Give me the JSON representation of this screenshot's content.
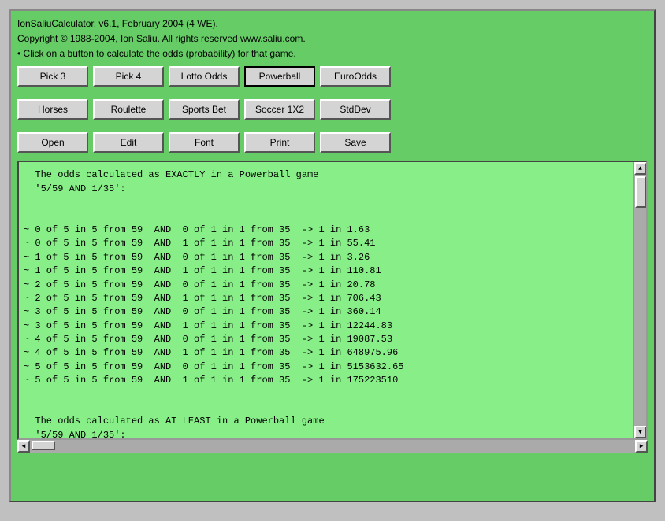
{
  "header": {
    "line1": "IonSaliuCalculator, v6.1, February 2004 (4 WE).",
    "line2": "Copyright © 1988-2004, Ion Saliu. All rights reserved www.saliu.com.",
    "line3": "• Click on a button to calculate the odds (probability) for that game."
  },
  "buttons_row1": [
    {
      "label": "Pick 3",
      "name": "pick3-button",
      "active": false
    },
    {
      "label": "Pick 4",
      "name": "pick4-button",
      "active": false
    },
    {
      "label": "Lotto Odds",
      "name": "lotto-odds-button",
      "active": false
    },
    {
      "label": "Powerball",
      "name": "powerball-button",
      "active": true
    },
    {
      "label": "EuroOdds",
      "name": "euroodds-button",
      "active": false
    }
  ],
  "buttons_row2": [
    {
      "label": "Horses",
      "name": "horses-button",
      "active": false
    },
    {
      "label": "Roulette",
      "name": "roulette-button",
      "active": false
    },
    {
      "label": "Sports Bet",
      "name": "sports-bet-button",
      "active": false
    },
    {
      "label": "Soccer 1X2",
      "name": "soccer-button",
      "active": false
    },
    {
      "label": "StdDev",
      "name": "stddev-button",
      "active": false
    }
  ],
  "buttons_row3": [
    {
      "label": "Open",
      "name": "open-button",
      "active": false
    },
    {
      "label": "Edit",
      "name": "edit-button",
      "active": false
    },
    {
      "label": "Font",
      "name": "font-button",
      "active": false
    },
    {
      "label": "Print",
      "name": "print-button",
      "active": false
    },
    {
      "label": "Save",
      "name": "save-button",
      "active": false
    }
  ],
  "output": {
    "content": "  The odds calculated as EXACTLY in a Powerball game\n  '5/59 AND 1/35':\n\n\n~ 0 of 5 in 5 from 59  AND  0 of 1 in 1 from 35  -> 1 in 1.63\n~ 0 of 5 in 5 from 59  AND  1 of 1 in 1 from 35  -> 1 in 55.41\n~ 1 of 5 in 5 from 59  AND  0 of 1 in 1 from 35  -> 1 in 3.26\n~ 1 of 5 in 5 from 59  AND  1 of 1 in 1 from 35  -> 1 in 110.81\n~ 2 of 5 in 5 from 59  AND  0 of 1 in 1 from 35  -> 1 in 20.78\n~ 2 of 5 in 5 from 59  AND  1 of 1 in 1 from 35  -> 1 in 706.43\n~ 3 of 5 in 5 from 59  AND  0 of 1 in 1 from 35  -> 1 in 360.14\n~ 3 of 5 in 5 from 59  AND  1 of 1 in 1 from 35  -> 1 in 12244.83\n~ 4 of 5 in 5 from 59  AND  0 of 1 in 1 from 35  -> 1 in 19087.53\n~ 4 of 5 in 5 from 59  AND  1 of 1 in 1 from 35  -> 1 in 648975.96\n~ 5 of 5 in 5 from 59  AND  0 of 1 in 1 from 35  -> 1 in 5153632.65\n~ 5 of 5 in 5 from 59  AND  1 of 1 in 1 from 35  -> 1 in 175223510\n\n\n  The odds calculated as AT LEAST in a Powerball game\n  '5/59 AND 1/35':\n"
  }
}
